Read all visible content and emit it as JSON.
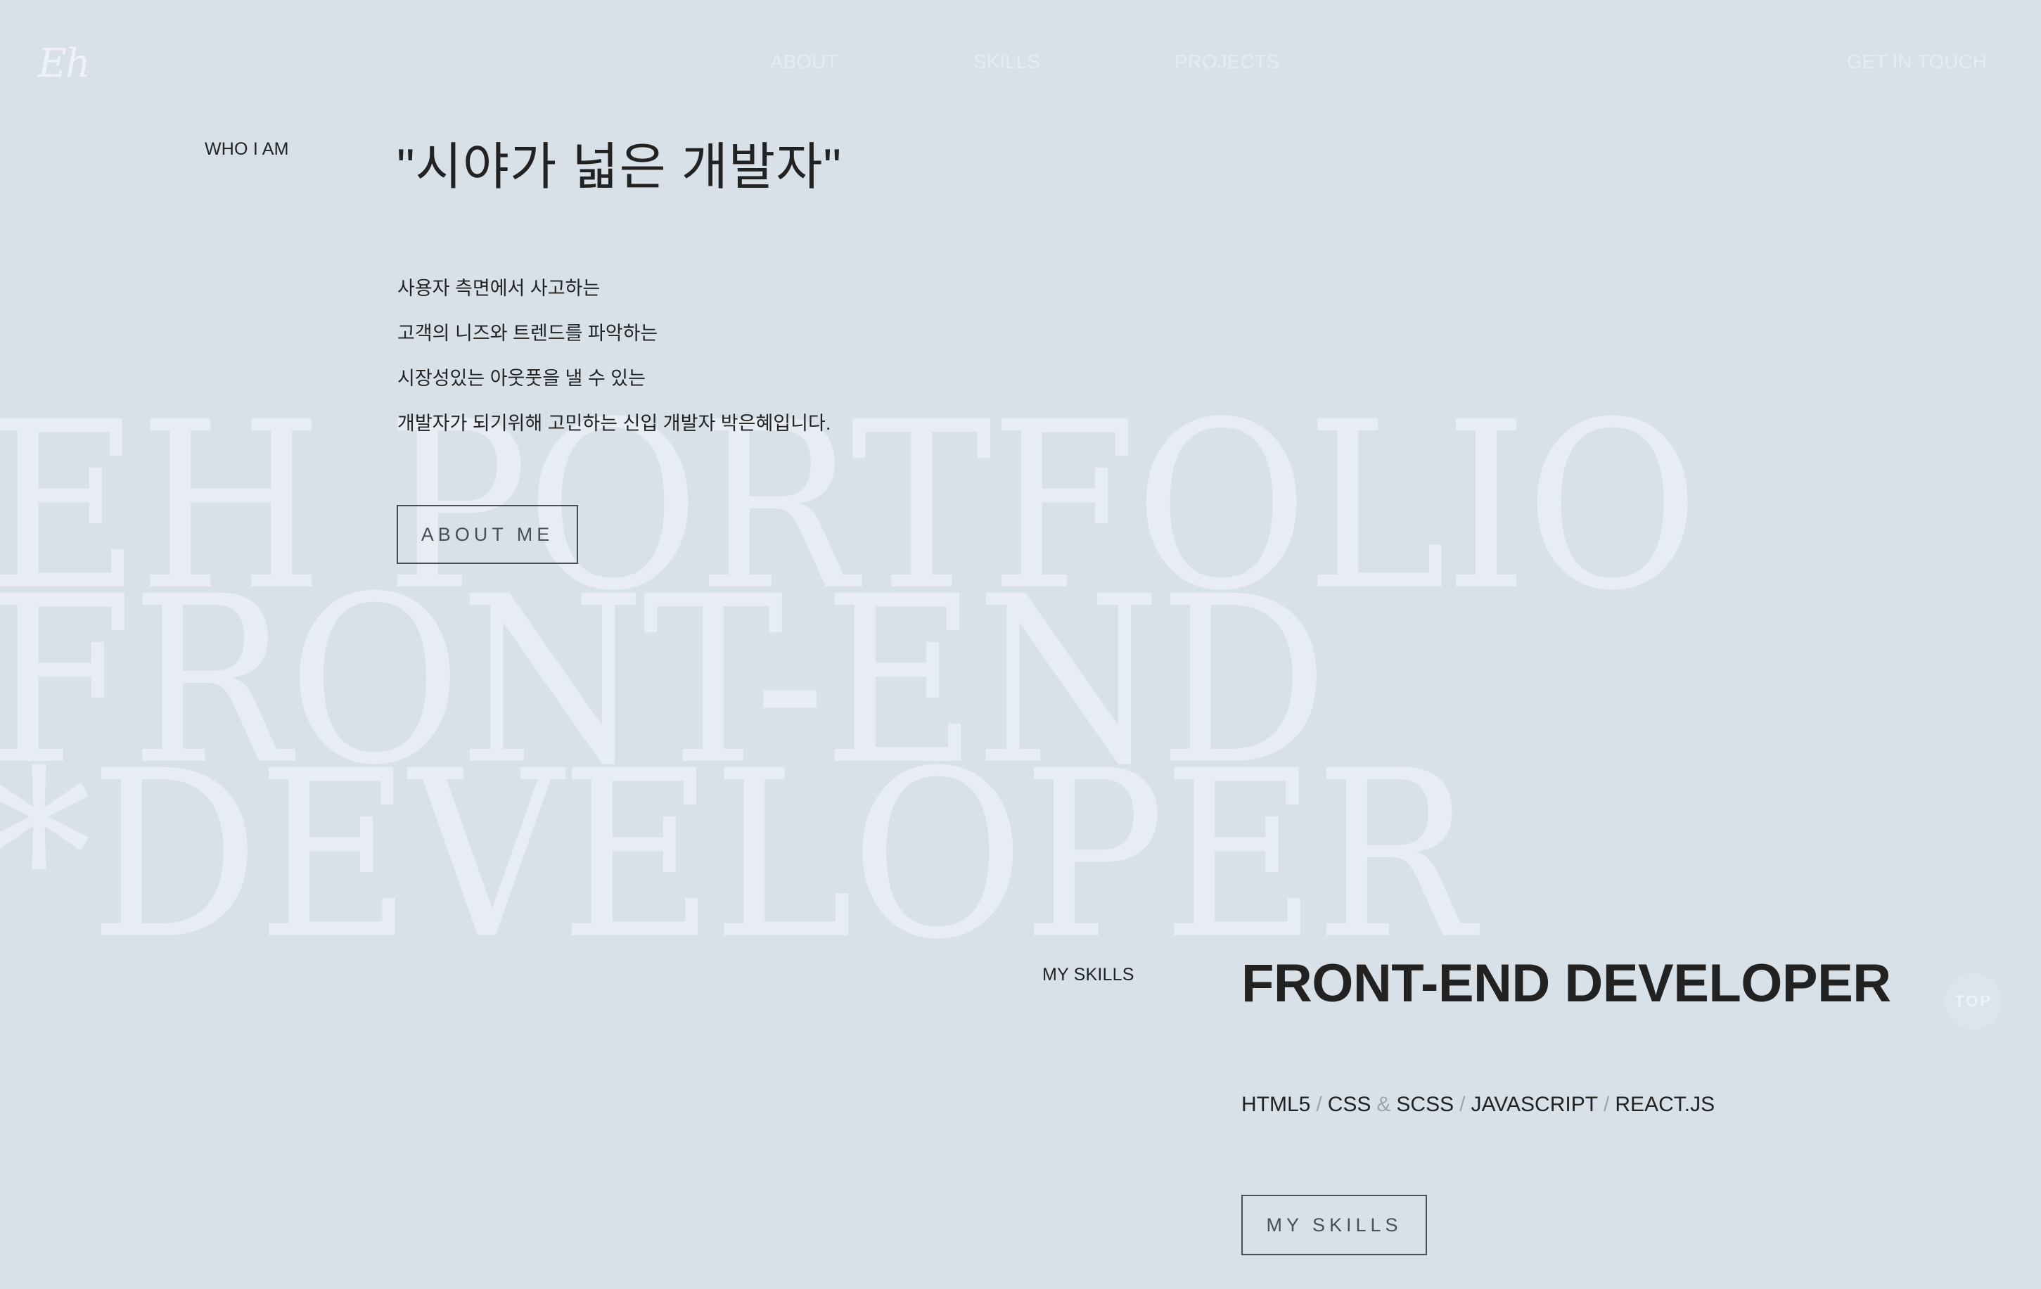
{
  "header": {
    "logo": "Eh",
    "nav": [
      "ABOUT",
      "SKILLS",
      "PROJECTS"
    ],
    "cta": "GET IN TOUCH"
  },
  "background_text": {
    "line1": "EH PORTFOLIO",
    "line2": "FRONT-END",
    "line3": "*DEVELOPER"
  },
  "who": {
    "label": "WHO I AM",
    "title": "\"시야가 넓은 개발자\"",
    "body": [
      "사용자 측면에서 사고하는",
      "고객의 니즈와 트렌드를 파악하는",
      "시장성있는 아웃풋을 낼 수 있는",
      "개발자가 되기위해 고민하는 신입 개발자 박은혜입니다."
    ],
    "button": "ABOUT ME"
  },
  "skills": {
    "label": "MY SKILLS",
    "title": "FRONT-END DEVELOPER",
    "items": [
      "HTML5",
      "CSS",
      "SCSS",
      "JAVASCRIPT",
      "REACT.JS"
    ],
    "separators": [
      "/",
      "&",
      "/",
      "/"
    ],
    "button": "MY SKILLS"
  },
  "top_button": "TOP",
  "colors": {
    "background": "#d8e0e8",
    "text": "#222222",
    "faint": "#e8edf4"
  }
}
